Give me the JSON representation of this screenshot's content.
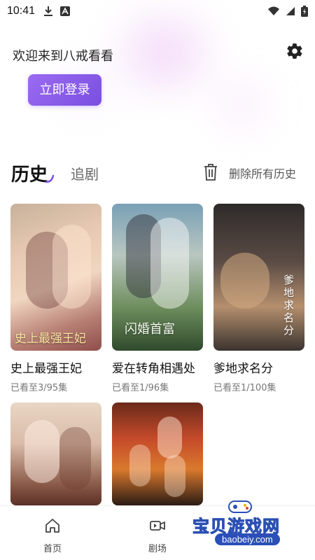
{
  "status_bar": {
    "time": "10:41"
  },
  "header": {
    "welcome": "欢迎来到八戒看看",
    "login_label": "立即登录"
  },
  "tabs": {
    "history": "历史",
    "follow": "追剧",
    "delete_all": "删除所有历史"
  },
  "history_items": [
    {
      "title": "史上最强王妃",
      "progress": "已看至3/95集",
      "poster_text": "史上最强王妃"
    },
    {
      "title": "爱在转角相遇处",
      "progress": "已看至1/96集",
      "poster_text": "闪婚首富"
    },
    {
      "title": "爹地求名分",
      "progress": "已看至1/100集",
      "poster_text": "爹地求名分"
    },
    {
      "title": "",
      "progress": "",
      "poster_text": ""
    },
    {
      "title": "",
      "progress": "",
      "poster_text": ""
    }
  ],
  "bottom_nav": {
    "home": "首页",
    "theater": "剧场"
  },
  "watermark": {
    "main": "宝贝游戏网",
    "url": "baobeiy.com"
  },
  "colors": {
    "accent": "#8a5cf0",
    "text": "#111111",
    "muted": "#777777"
  }
}
